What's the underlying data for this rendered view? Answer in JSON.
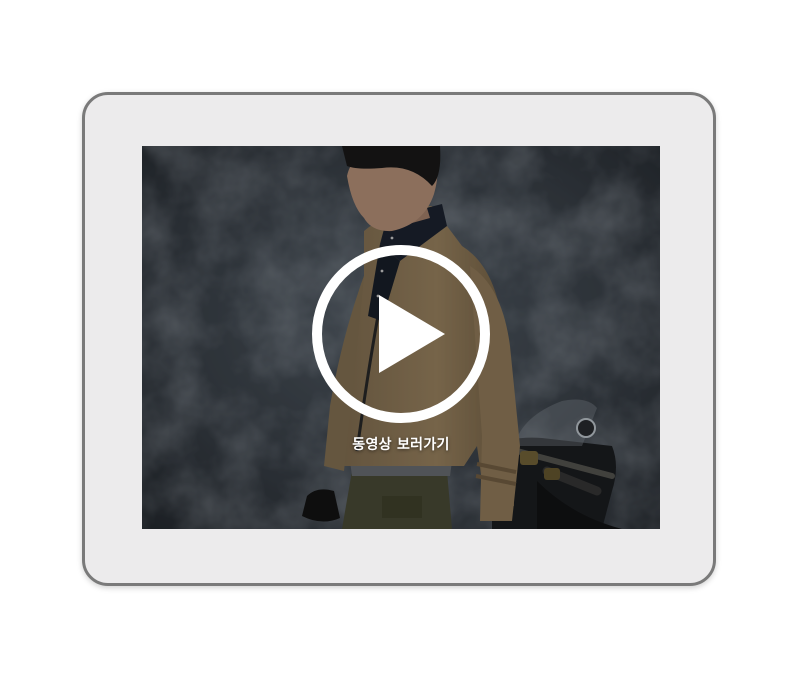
{
  "video": {
    "play_label": "동영상 보러가기",
    "play_icon": "play-circle-icon"
  },
  "colors": {
    "frame_border": "#7a7a7a",
    "frame_fill": "#ecebec",
    "backdrop": "#3e454d",
    "overlay": "#000000",
    "play_icon": "#ffffff"
  }
}
